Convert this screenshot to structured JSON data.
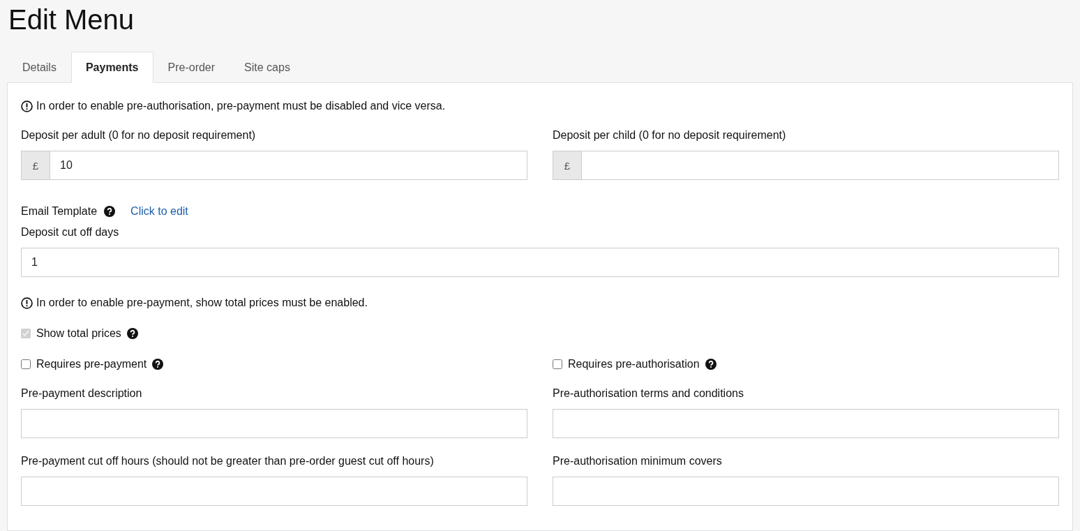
{
  "title": "Edit Menu",
  "tabs": [
    {
      "label": "Details",
      "selected": false
    },
    {
      "label": "Payments",
      "selected": true
    },
    {
      "label": "Pre-order",
      "selected": false
    },
    {
      "label": "Site caps",
      "selected": false
    }
  ],
  "notice_top": "In order to enable pre-authorisation, pre-payment must be disabled and vice versa.",
  "deposit_fields": [
    {
      "label": "Deposit per adult (0 for no deposit requirement)",
      "prefix": "£",
      "value": "10"
    },
    {
      "label": "Deposit per child (0 for no deposit requirement)",
      "prefix": "£"
    }
  ],
  "email_template": {
    "label": "Email Template",
    "link": "Click to edit"
  },
  "cut_off_days": {
    "label": "Deposit cut off days",
    "value": "1"
  },
  "notice_prices": "In order to enable pre-payment, show total prices must be enabled.",
  "show_total_prices": {
    "label": "Show total prices",
    "checked": true,
    "disabled": true
  },
  "requirement_checks": [
    {
      "label": "Requires pre-payment",
      "checked": false,
      "disabled": false
    },
    {
      "label": "Requires pre-authorisation",
      "checked": false,
      "disabled": false
    }
  ],
  "text_fields": [
    {
      "label": "Pre-payment description"
    },
    {
      "label": "Pre-authorisation terms and conditions"
    },
    {
      "label": "Pre-payment cut off hours (should not be greater than pre-order guest cut off hours)"
    },
    {
      "label": "Pre-authorisation minimum covers"
    }
  ]
}
